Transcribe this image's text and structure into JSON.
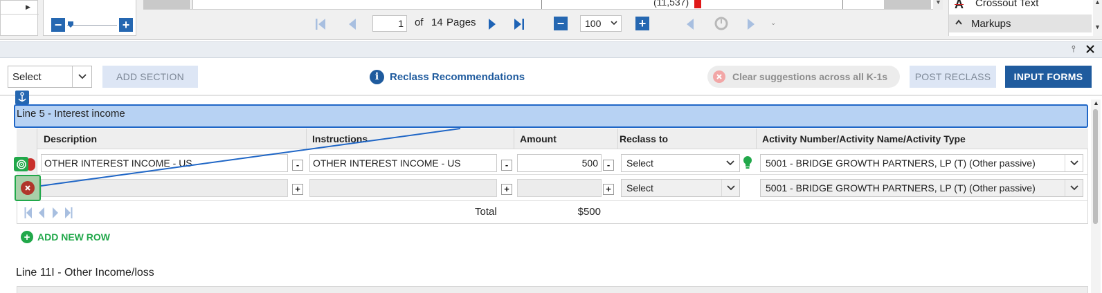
{
  "viewer": {
    "page_current": "1",
    "page_of": "of",
    "page_total": "14",
    "page_unit": "Pages",
    "zoom": "100",
    "doc_value": "(11,537)",
    "markup_items": [
      "Crossout Text",
      "Markups"
    ]
  },
  "toolbar": {
    "section_select": "Select",
    "add_section": "ADD SECTION",
    "reclass_recommendations": "Reclass Recommendations",
    "clear_suggestions": "Clear suggestions across all K-1s",
    "post_reclass": "POST RECLASS",
    "input_forms": "INPUT FORMS"
  },
  "sections": [
    {
      "title": "Line 5 - Interest income",
      "columns": [
        "Description",
        "Instructions",
        "Amount",
        "Reclass to",
        "Activity Number/Activity Name/Activity Type"
      ],
      "rows": [
        {
          "description": "OTHER INTEREST INCOME - US",
          "instructions": "OTHER INTEREST INCOME - US",
          "amount": "500",
          "reclass": "Select",
          "activity": "5001 - BRIDGE GROWTH PARTNERS, LP (T) (Other passive)"
        },
        {
          "description": "",
          "instructions": "",
          "amount": "",
          "reclass": "Select",
          "activity": "5001 - BRIDGE GROWTH PARTNERS, LP (T) (Other passive)"
        }
      ],
      "total_label": "Total",
      "total_value": "$500",
      "add_row": "ADD NEW ROW"
    },
    {
      "title": "Line 11I - Other Income/loss"
    }
  ],
  "colors": {
    "primary": "#1f5b9e",
    "section_highlight": "#b7d2f3",
    "green": "#21a84a",
    "red": "#b0352b"
  }
}
